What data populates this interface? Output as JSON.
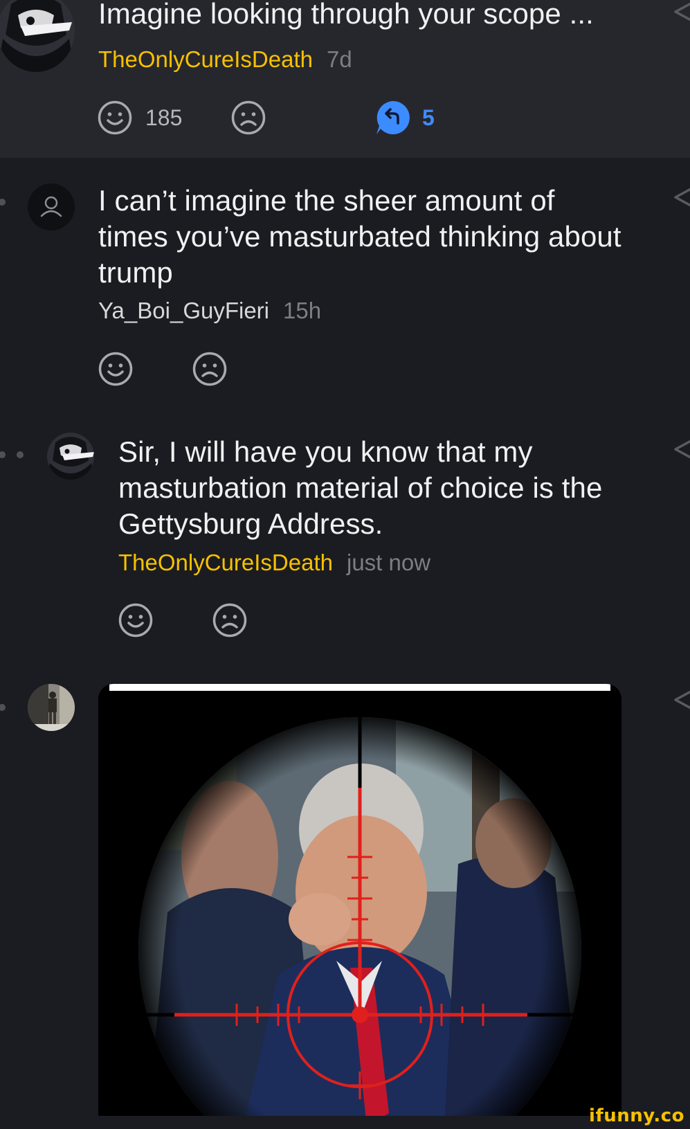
{
  "comments": [
    {
      "text": "Imagine looking through your scope ...",
      "author": "TheOnlyCureIsDeath",
      "time": "7d",
      "smiles": "185",
      "replies": "5"
    },
    {
      "text": "I can’t imagine the sheer amount of times you’ve masturbated thinking about trump",
      "author": "Ya_Boi_GuyFieri",
      "time": "15h"
    },
    {
      "text": "Sir, I will have you know that my masturbation material of choice is the Gettysburg Address.",
      "author": "TheOnlyCureIsDeath",
      "time": "just now"
    }
  ],
  "watermark": "ifunny.co",
  "colors": {
    "background": "#1b1c21",
    "highlight_background": "#26272d",
    "author_accent": "#f7c100",
    "reply_accent": "#3d8cff",
    "crosshair": "#e0201c"
  },
  "icons": [
    "smile-icon",
    "frown-icon",
    "reply-icon",
    "share-icon",
    "user-placeholder-icon"
  ]
}
